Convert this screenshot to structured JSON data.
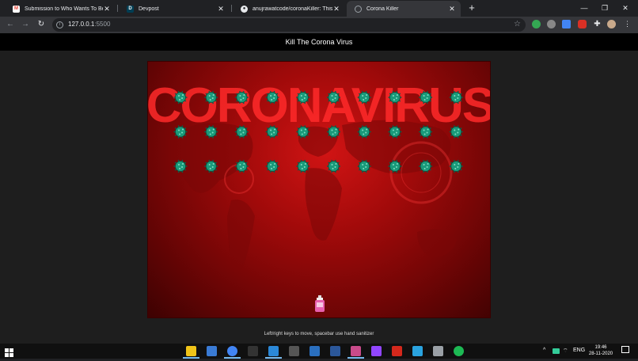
{
  "browser": {
    "tabs": [
      {
        "title": "Submission to Who Wants To Be A Hacker",
        "icon": "gmail-icon",
        "color": "#ea4335",
        "active": false
      },
      {
        "title": "Devpost",
        "icon": "devpost-icon",
        "color": "#003e54",
        "active": false
      },
      {
        "title": "anujrawatcode/coronaKiller: This is",
        "icon": "github-icon",
        "color": "#e8eaed",
        "active": false
      },
      {
        "title": "Corona Killer",
        "icon": "globe-icon",
        "color": "#9aa0a6",
        "active": true
      }
    ],
    "new_tab_label": "+",
    "url_host": "127.0.0.1",
    "url_port": ":5500"
  },
  "page": {
    "header_title": "Kill The Corona Virus",
    "instructions": "Left/right keys to move, spacebar use hand sanitizer"
  },
  "game": {
    "banner_text": "CORONAVIRUS",
    "virus_grid": {
      "rows": 3,
      "cols": 10
    },
    "player": "hand-sanitizer-bottle",
    "player_position": 0.5
  },
  "taskbar": {
    "apps": [
      "file-explorer-icon",
      "python-icon",
      "chrome-icon",
      "terminal-icon",
      "vscode-icon",
      "calculator-icon",
      "photos-icon",
      "word-icon",
      "snipping-icon",
      "twitch-icon",
      "acrobat-icon",
      "telegram-icon",
      "settings-icon",
      "spotify-icon"
    ],
    "language": "ENG",
    "time": "19:46",
    "date": "28-11-2020"
  },
  "colors": {
    "virus": "#1a9a7a",
    "game_background": "#a10a0a",
    "header": "#000000"
  }
}
